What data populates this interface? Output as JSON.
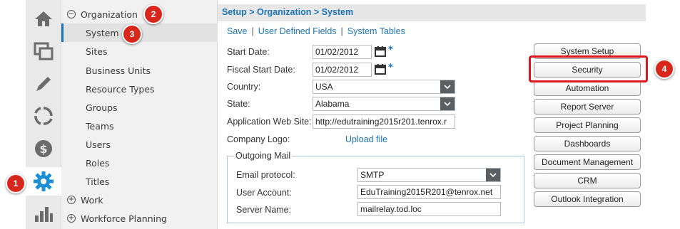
{
  "rail": {
    "icons": [
      "home-icon",
      "windows-icon",
      "pencil-icon",
      "cycle-icon",
      "dollar-icon",
      "gear-icon",
      "bar-chart-icon"
    ]
  },
  "tree": {
    "organization": "Organization",
    "items": [
      "System",
      "Sites",
      "Business Units",
      "Resource Types",
      "Groups",
      "Teams",
      "Users",
      "Roles",
      "Titles"
    ],
    "work": "Work",
    "workforce": "Workforce Planning"
  },
  "header": {
    "breadcrumb": "Setup > Organization > System"
  },
  "links": {
    "save": "Save",
    "udf": "User Defined Fields",
    "tables": "System Tables",
    "sep": "|"
  },
  "form": {
    "start_date_label": "Start Date:",
    "start_date": "01/02/2012",
    "fiscal_label": "Fiscal Start Date:",
    "fiscal_date": "01/02/2012",
    "required": "*",
    "country_label": "Country:",
    "country": "USA",
    "state_label": "State:",
    "state": "Alabama",
    "website_label": "Application Web Site:",
    "website": "http://edutraining2015r201.tenrox.r",
    "logo_label": "Company Logo:",
    "upload": "Upload file"
  },
  "mail": {
    "legend": "Outgoing Mail",
    "protocol_label": "Email protocol:",
    "protocol": "SMTP",
    "account_label": "User Account:",
    "account": "EduTraining2015R201@tenrox.net",
    "server_label": "Server Name:",
    "server": "mailrelay.tod.loc"
  },
  "buttons": [
    "System Setup",
    "Security",
    "Automation",
    "Report Server",
    "Project Planning",
    "Dashboards",
    "Document Management",
    "CRM",
    "Outlook Integration"
  ],
  "callouts": [
    "1",
    "2",
    "3",
    "4"
  ],
  "colors": {
    "accent": "#1c74b7",
    "callout": "#d9261c",
    "rail": "#e9e9e9"
  }
}
